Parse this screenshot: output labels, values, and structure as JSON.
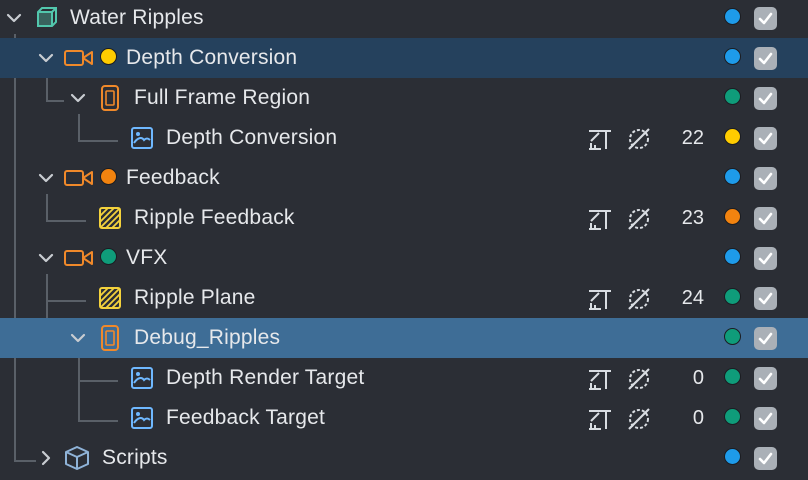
{
  "colors": {
    "blue": "#1e9bea",
    "yellow": "#ffcc00",
    "green": "#0f9c7a",
    "orange": "#f2830f",
    "camera": "#f0892a",
    "image": "#6fb8ff",
    "group": "#52c7ad",
    "plane": "#f4d23c",
    "scripts": "#8fb3d8"
  },
  "tree": {
    "rows": [
      {
        "label": "Water Ripples",
        "icon": "cube-group-icon",
        "layer_color": "blue",
        "enabled": true,
        "expanded": true
      },
      {
        "label": "Depth Conversion",
        "icon": "camera-icon",
        "camera_dot": "yellow",
        "layer_color": "blue",
        "enabled": true,
        "expanded": true,
        "selected": true
      },
      {
        "label": "Full Frame Region",
        "icon": "screen-region-icon",
        "layer_color": "green",
        "enabled": true,
        "expanded": true
      },
      {
        "label": "Depth Conversion",
        "icon": "image-icon",
        "render_order": "22",
        "layer_color": "yellow",
        "enabled": true
      },
      {
        "label": "Feedback",
        "icon": "camera-icon",
        "camera_dot": "orange",
        "layer_color": "blue",
        "enabled": true,
        "expanded": true
      },
      {
        "label": "Ripple Feedback",
        "icon": "plane-icon",
        "render_order": "23",
        "layer_color": "orange",
        "enabled": true
      },
      {
        "label": "VFX",
        "icon": "camera-icon",
        "camera_dot": "green",
        "layer_color": "blue",
        "enabled": true,
        "expanded": true
      },
      {
        "label": "Ripple Plane",
        "icon": "plane-icon",
        "render_order": "24",
        "layer_color": "green",
        "enabled": true
      },
      {
        "label": "Debug_Ripples",
        "icon": "screen-region-icon",
        "layer_color": "green",
        "enabled": true,
        "expanded": true,
        "selected": true
      },
      {
        "label": "Depth Render Target",
        "icon": "image-icon",
        "render_order": "0",
        "layer_color": "green",
        "enabled": true
      },
      {
        "label": "Feedback Target",
        "icon": "image-icon",
        "render_order": "0",
        "layer_color": "green",
        "enabled": true
      },
      {
        "label": "Scripts",
        "icon": "scripts-cube-icon",
        "layer_color": "blue",
        "enabled": true,
        "expanded": false
      }
    ]
  },
  "row_tools": {
    "stretch": "stretch-mode-icon",
    "no_depth": "no-depth-icon"
  }
}
